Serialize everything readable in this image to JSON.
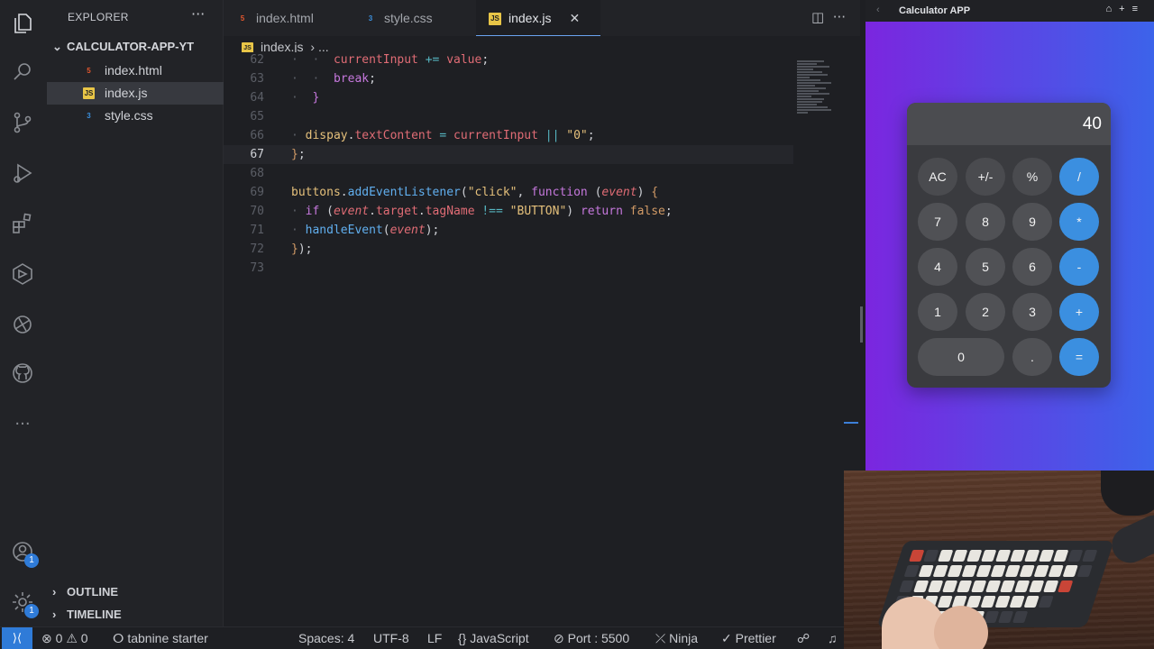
{
  "sidebar": {
    "title": "EXPLORER",
    "more": "···",
    "folder": "CALCULATOR-APP-YT",
    "files": [
      {
        "name": "index.html",
        "icon": "html-file-icon",
        "glyph": "5"
      },
      {
        "name": "index.js",
        "icon": "js-file-icon",
        "glyph": "JS"
      },
      {
        "name": "style.css",
        "icon": "css-file-icon",
        "glyph": "3"
      }
    ],
    "outline": "OUTLINE",
    "timeline": "TIMELINE"
  },
  "tabs": [
    {
      "label": "index.html",
      "glyph": "5"
    },
    {
      "label": "style.css",
      "glyph": "3"
    },
    {
      "label": "index.js",
      "glyph": "JS"
    }
  ],
  "tab_close": "✕",
  "breadcrumb": {
    "file": "index.js",
    "sep": "›",
    "rest": "..."
  },
  "code": {
    "l62": "62",
    "l63": "63",
    "l64": "64",
    "l65": "65",
    "l66": "66",
    "l67": "67",
    "l68": "68",
    "l69": "69",
    "l70": "70",
    "l71": "71",
    "l72": "72",
    "l73": "73"
  },
  "preview": {
    "title": "Calculator APP",
    "display": "40",
    "keys": [
      "AC",
      "+/-",
      "%",
      "/",
      "7",
      "8",
      "9",
      "*",
      "4",
      "5",
      "6",
      "-",
      "1",
      "2",
      "3",
      "+",
      "0",
      ".",
      "="
    ]
  },
  "status": {
    "errors": "0",
    "warnings": "0",
    "tabnine": "tabnine starter",
    "spaces": "Spaces: 4",
    "encoding": "UTF-8",
    "eol": "LF",
    "language": "JavaScript",
    "port": "Port : 5500",
    "ninja": "Ninja",
    "prettier": "Prettier"
  },
  "badges": {
    "accounts": "1",
    "settings": "1"
  }
}
